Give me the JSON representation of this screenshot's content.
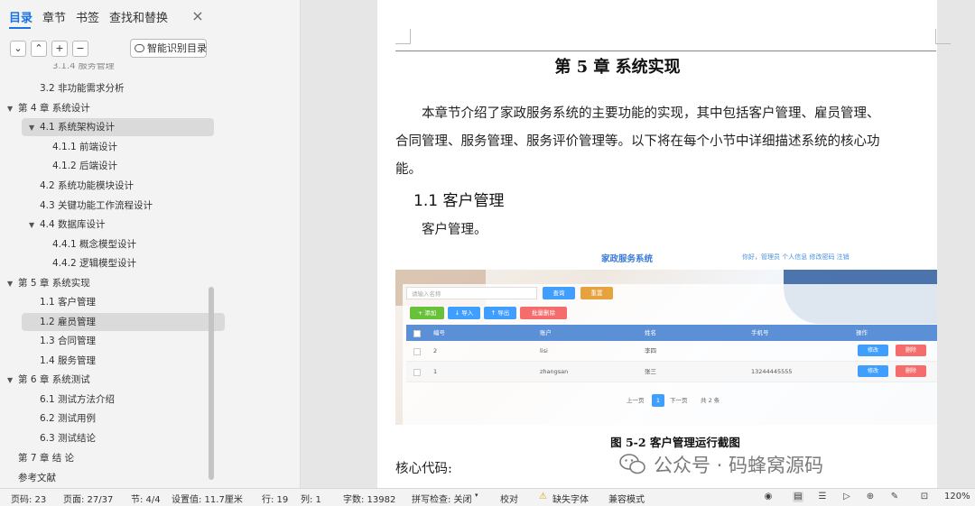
{
  "sidebar": {
    "tabs": [
      {
        "label": "目录",
        "active": true
      },
      {
        "label": "章节"
      },
      {
        "label": "书签"
      },
      {
        "label": "查找和替换"
      }
    ],
    "close_glyph": "×",
    "tool_buttons": [
      "⌄",
      "⌃",
      "+",
      "−"
    ],
    "smart_button": "智能识别目录",
    "toc_cutoff": "3.1.4  服务管理",
    "toc": [
      {
        "label": "3.2   非功能需求分析",
        "level": 2
      },
      {
        "label": "第 4 章  系统设计",
        "level": 1,
        "expanded": true
      },
      {
        "label": "4.1   系统架构设计",
        "level": 2,
        "expanded": true,
        "selected": true
      },
      {
        "label": "4.1.1   前端设计",
        "level": 3
      },
      {
        "label": "4.1.2   后端设计",
        "level": 3
      },
      {
        "label": "4.2   系统功能模块设计",
        "level": 2
      },
      {
        "label": "4.3   关键功能工作流程设计",
        "level": 2
      },
      {
        "label": "4.4   数据库设计",
        "level": 2,
        "expanded": true
      },
      {
        "label": "4.4.1   概念模型设计",
        "level": 3
      },
      {
        "label": "4.4.2   逻辑模型设计",
        "level": 3
      },
      {
        "label": "第 5 章  系统实现",
        "level": 1,
        "expanded": true
      },
      {
        "label": "1.1  客户管理",
        "level": 2
      },
      {
        "label": "1.2  雇员管理",
        "level": 2,
        "selected": true
      },
      {
        "label": "1.3  合同管理",
        "level": 2
      },
      {
        "label": "1.4  服务管理",
        "level": 2
      },
      {
        "label": "第 6 章  系统测试",
        "level": 1,
        "expanded": true
      },
      {
        "label": "6.1   测试方法介绍",
        "level": 2
      },
      {
        "label": "6.2   测试用例",
        "level": 2
      },
      {
        "label": "6.3   测试结论",
        "level": 2
      },
      {
        "label": "第 7 章   结    论",
        "level": 1
      },
      {
        "label": "参考文献",
        "level": 1
      }
    ]
  },
  "document": {
    "chapter_title": "第 5 章  系统实现",
    "intro_lines": [
      "本章节介绍了家政服务系统的主要功能的实现，其中包括客户管理、雇员管理、",
      "合同管理、服务管理、服务评价管理等。以下将在每个小节中详细描述系统的核心功",
      "能。"
    ],
    "section_title": "1.1   客户管理",
    "section_text": "客户管理。",
    "figure": {
      "app_title": "家政服务系统",
      "nav_text": "你好，管理员   个人信息   修改密码   注销",
      "search_placeholder": "请输入名称",
      "btn_search": "查询",
      "btn_reset": "重置",
      "btn_add": "+ 添加",
      "btn_import": "↓ 导入",
      "btn_export": "↑ 导出",
      "btn_batch_delete": "批量删除",
      "columns": [
        "编号",
        "账户",
        "姓名",
        "手机号",
        "操作"
      ],
      "rows": [
        [
          "2",
          "lisi",
          "李四",
          ""
        ],
        [
          "1",
          "zhangsan",
          "张三",
          "13244445555"
        ]
      ],
      "edit_label": "修改",
      "delete_label": "删除",
      "pager": {
        "prev": "上一页",
        "current": "1",
        "next": "下一页",
        "total": "共 2 条"
      }
    },
    "caption": "图 5-2  客户管理运行截图",
    "core_code_label": "核心代码:",
    "watermark": "公众号 · 码蜂窝源码"
  },
  "status_bar": {
    "page_count": "页码: 23",
    "page": "页面: 27/37",
    "section": "节: 4/4",
    "setting": "设置值: 11.7厘米",
    "row": "行: 19",
    "col": "列: 1",
    "word_count": "字数: 13982",
    "spell_check": "拼写检查: 关闭",
    "proofread": "校对",
    "missing_font": "缺失字体",
    "compat_mode": "兼容模式",
    "zoom": "120%"
  }
}
